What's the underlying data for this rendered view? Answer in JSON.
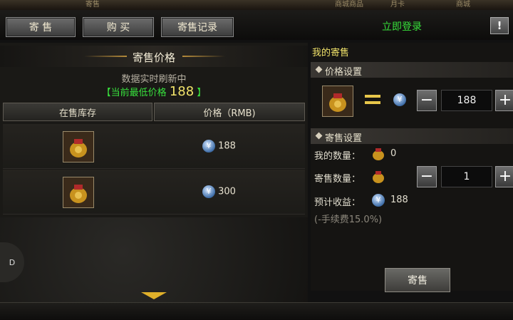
{
  "topstrip": {
    "items": [
      "寄售",
      "商城商品",
      "月卡",
      "商城"
    ]
  },
  "tabs": [
    {
      "label": "寄 售"
    },
    {
      "label": "购 买"
    },
    {
      "label": "寄售记录"
    }
  ],
  "login": "立即登录",
  "warn": "!",
  "left": {
    "title": "寄售价格",
    "subtitle": "数据实时刷新中",
    "min_price_label": "【当前最低价格",
    "min_price_value": "188",
    "min_price_suffix": "】",
    "headers": [
      "在售库存",
      "价格（RMB)"
    ],
    "rows": [
      {
        "price": "188"
      },
      {
        "price": "300"
      }
    ]
  },
  "right": {
    "heading": "我的寄售",
    "price_section": "价格设置",
    "price_value": "188",
    "sell_section": "寄售设置",
    "my_qty_label": "我的数量：",
    "my_qty_value": "0",
    "sell_qty_label": "寄售数量：",
    "sell_qty_value": "1",
    "expected_label": "预计收益：",
    "expected_value": "188",
    "fee_note": "(-手续费15.0%)",
    "sell_button": "寄售"
  },
  "side": {
    "label": "D"
  },
  "colors": {
    "accent_green": "#38e03d",
    "accent_yellow": "#f1e36a",
    "coin_blue": "#3f6ea8"
  }
}
